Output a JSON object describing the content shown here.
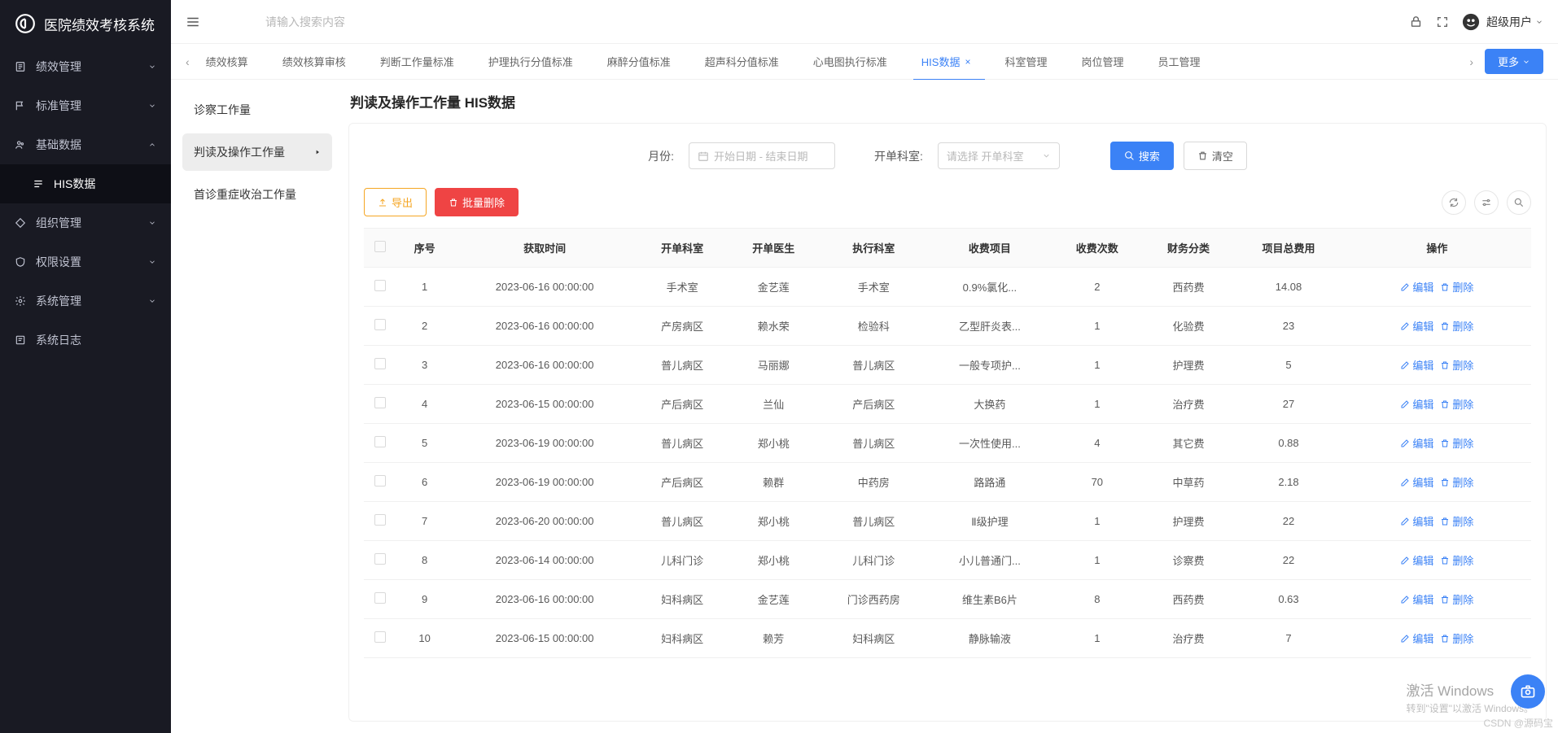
{
  "app_name": "医院绩效考核系统",
  "search_placeholder": "请输入搜索内容",
  "user": {
    "name": "超级用户"
  },
  "sidebar": {
    "items": [
      {
        "label": "绩效管理"
      },
      {
        "label": "标准管理"
      },
      {
        "label": "基础数据"
      },
      {
        "label": "组织管理"
      },
      {
        "label": "权限设置"
      },
      {
        "label": "系统管理"
      },
      {
        "label": "系统日志"
      }
    ],
    "sub": {
      "his_data": "HIS数据"
    }
  },
  "tabs": {
    "items": [
      "绩效核算",
      "绩效核算审核",
      "判断工作量标准",
      "护理执行分值标准",
      "麻醉分值标准",
      "超声科分值标准",
      "心电图执行标准",
      "HIS数据",
      "科室管理",
      "岗位管理",
      "员工管理"
    ],
    "active_index": 7,
    "more": "更多"
  },
  "subnav": {
    "items": [
      "诊察工作量",
      "判读及操作工作量",
      "首诊重症收治工作量"
    ],
    "active_index": 1
  },
  "page": {
    "title": "判读及操作工作量 HIS数据"
  },
  "filters": {
    "month_label": "月份:",
    "date_placeholder": "开始日期 - 结束日期",
    "dept_label": "开单科室:",
    "dept_placeholder": "请选择 开单科室",
    "search": "搜索",
    "clear": "清空"
  },
  "toolbar": {
    "export": "导出",
    "batch_delete": "批量删除"
  },
  "table": {
    "columns": [
      "序号",
      "获取时间",
      "开单科室",
      "开单医生",
      "执行科室",
      "收费项目",
      "收费次数",
      "财务分类",
      "项目总费用",
      "操作"
    ],
    "op_edit": "编辑",
    "op_del": "删除",
    "rows": [
      {
        "idx": "1",
        "time": "2023-06-16 00:00:00",
        "dept": "手术室",
        "doctor": "金艺莲",
        "exec": "手术室",
        "item": "0.9%氯化...",
        "count": "2",
        "cat": "西药费",
        "cost": "14.08"
      },
      {
        "idx": "2",
        "time": "2023-06-16 00:00:00",
        "dept": "产房病区",
        "doctor": "赖水荣",
        "exec": "检验科",
        "item": "乙型肝炎表...",
        "count": "1",
        "cat": "化验费",
        "cost": "23"
      },
      {
        "idx": "3",
        "time": "2023-06-16 00:00:00",
        "dept": "普儿病区",
        "doctor": "马丽娜",
        "exec": "普儿病区",
        "item": "一般专项护...",
        "count": "1",
        "cat": "护理费",
        "cost": "5"
      },
      {
        "idx": "4",
        "time": "2023-06-15 00:00:00",
        "dept": "产后病区",
        "doctor": "兰仙",
        "exec": "产后病区",
        "item": "大换药",
        "count": "1",
        "cat": "治疗费",
        "cost": "27"
      },
      {
        "idx": "5",
        "time": "2023-06-19 00:00:00",
        "dept": "普儿病区",
        "doctor": "郑小桃",
        "exec": "普儿病区",
        "item": "一次性使用...",
        "count": "4",
        "cat": "其它费",
        "cost": "0.88"
      },
      {
        "idx": "6",
        "time": "2023-06-19 00:00:00",
        "dept": "产后病区",
        "doctor": "赖群",
        "exec": "中药房",
        "item": "路路通",
        "count": "70",
        "cat": "中草药",
        "cost": "2.18"
      },
      {
        "idx": "7",
        "time": "2023-06-20 00:00:00",
        "dept": "普儿病区",
        "doctor": "郑小桃",
        "exec": "普儿病区",
        "item": "Ⅱ级护理",
        "count": "1",
        "cat": "护理费",
        "cost": "22"
      },
      {
        "idx": "8",
        "time": "2023-06-14 00:00:00",
        "dept": "儿科门诊",
        "doctor": "郑小桃",
        "exec": "儿科门诊",
        "item": "小儿普通门...",
        "count": "1",
        "cat": "诊察费",
        "cost": "22"
      },
      {
        "idx": "9",
        "time": "2023-06-16 00:00:00",
        "dept": "妇科病区",
        "doctor": "金艺莲",
        "exec": "门诊西药房",
        "item": "维生素B6片",
        "count": "8",
        "cat": "西药费",
        "cost": "0.63"
      },
      {
        "idx": "10",
        "time": "2023-06-15 00:00:00",
        "dept": "妇科病区",
        "doctor": "赖芳",
        "exec": "妇科病区",
        "item": "静脉输液",
        "count": "1",
        "cat": "治疗费",
        "cost": "7"
      }
    ]
  },
  "watermark": {
    "title": "激活 Windows",
    "sub": "转到\"设置\"以激活 Windows。"
  },
  "csdn": "CSDN @源码宝"
}
